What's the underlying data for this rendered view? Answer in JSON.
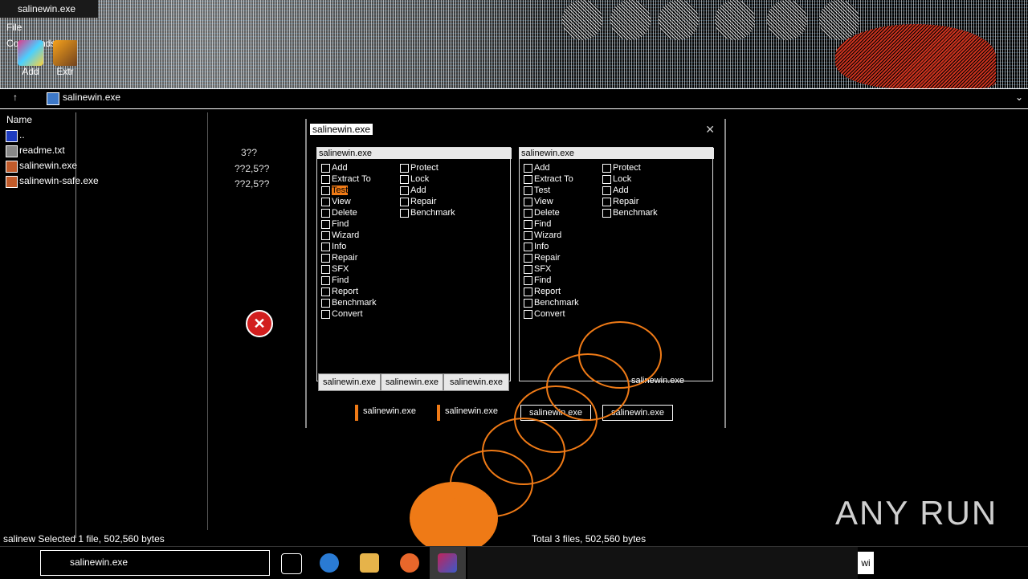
{
  "window": {
    "title": "salinewin.exe"
  },
  "menu": [
    "File",
    "Commands"
  ],
  "toolbar": [
    {
      "label": "Add"
    },
    {
      "label": "Extr"
    }
  ],
  "address": {
    "path": "salinewin.exe"
  },
  "columns": {
    "name": "Name"
  },
  "files": [
    {
      "name": "..",
      "size": ""
    },
    {
      "name": "readme.txt",
      "size": "3??"
    },
    {
      "name": "salinewin.exe",
      "size": "??2,5??"
    },
    {
      "name": "salinewin-safe.exe",
      "size": "??2,5??"
    }
  ],
  "dialog": {
    "title": "salinewin.exe",
    "left_pane": {
      "header": "salinewin.exe",
      "items": [
        "Add",
        "Extract To",
        "Test",
        "View",
        "Delete",
        "Find",
        "Wizard",
        "Info",
        "Repair",
        "SFX",
        "",
        "Find",
        "Report",
        "Benchmark",
        "Convert"
      ],
      "items2": [
        "Protect",
        "Lock",
        "Add",
        "Repair",
        "Benchmark"
      ]
    },
    "right_pane": {
      "header": "salinewin.exe",
      "items": [
        "Add",
        "Extract To",
        "Test",
        "View",
        "Delete",
        "Find",
        "Wizard",
        "Info",
        "Repair",
        "SFX",
        "",
        "Find",
        "Report",
        "Benchmark",
        "Convert"
      ],
      "items2": [
        "Protect",
        "Lock",
        "Add",
        "Repair",
        "Benchmark"
      ]
    },
    "tabs": [
      "salinewin.exe",
      "salinewin.exe",
      "salinewin.exe"
    ],
    "right_btn_label": "salinewin.exe",
    "bottom_buttons": [
      "salinewin.exe",
      "salinewin.exe",
      "salinewin.exe",
      "salinewin.exe"
    ]
  },
  "status": {
    "left": "salinew Selected 1 file, 502,560 bytes",
    "right": "Total 3 files, 502,560 bytes"
  },
  "taskbar": {
    "search_value": "salinewin.exe",
    "right_label": "wi"
  },
  "watermark": "ANY RUN"
}
